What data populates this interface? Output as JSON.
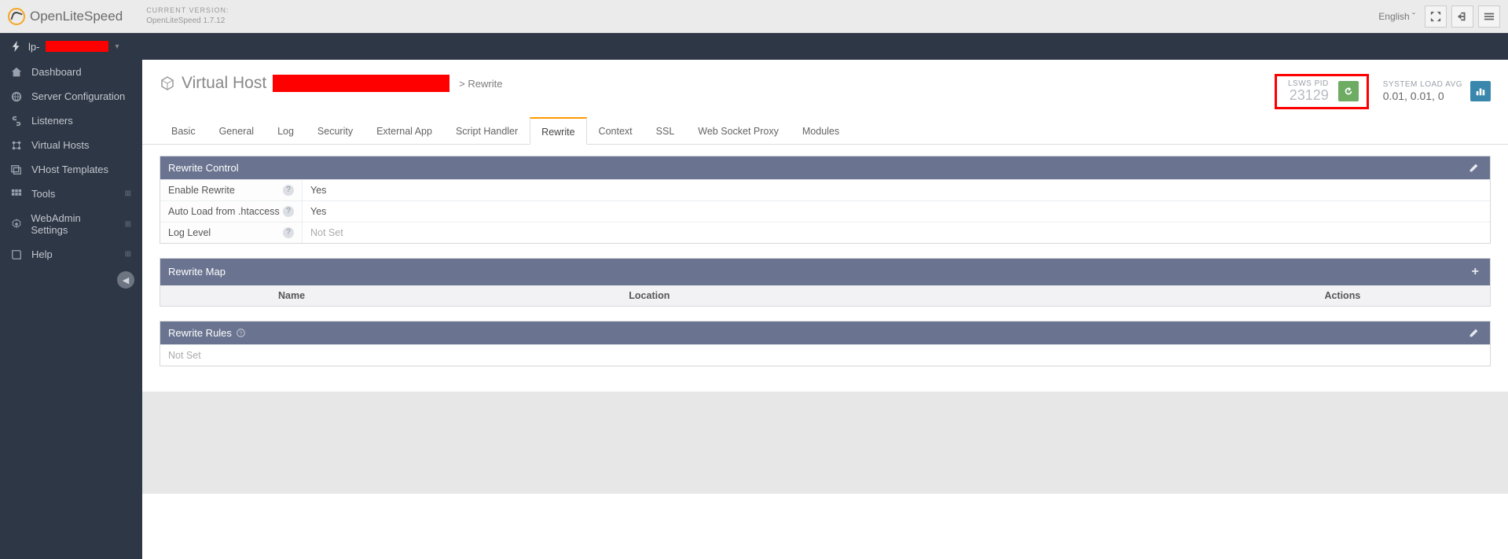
{
  "header": {
    "brand_thin": "Open",
    "brand_mid": "Lite",
    "brand_bold": "Speed",
    "current_version_label": "CURRENT VERSION:",
    "current_version_value": "OpenLiteSpeed 1.7.12",
    "language": "English"
  },
  "serverbar": {
    "prefix": "lp-"
  },
  "sidebar": {
    "items": [
      {
        "icon": "home",
        "label": "Dashboard"
      },
      {
        "icon": "globe",
        "label": "Server Configuration"
      },
      {
        "icon": "link",
        "label": "Listeners"
      },
      {
        "icon": "vhost",
        "label": "Virtual Hosts"
      },
      {
        "icon": "template",
        "label": "VHost Templates"
      },
      {
        "icon": "grid",
        "label": "Tools",
        "expand": true
      },
      {
        "icon": "gear",
        "label": "WebAdmin Settings",
        "expand": true
      },
      {
        "icon": "book",
        "label": "Help",
        "expand": true
      }
    ]
  },
  "page": {
    "title_prefix": "Virtual Host",
    "breadcrumb": "> Rewrite",
    "pid_label": "LSWS PID",
    "pid_value": "23129",
    "load_label": "SYSTEM LOAD AVG",
    "load_value": "0.01, 0.01, 0"
  },
  "tabs": [
    "Basic",
    "General",
    "Log",
    "Security",
    "External App",
    "Script Handler",
    "Rewrite",
    "Context",
    "SSL",
    "Web Socket Proxy",
    "Modules"
  ],
  "active_tab": "Rewrite",
  "panel_control": {
    "title": "Rewrite Control",
    "rows": [
      {
        "k": "Enable Rewrite",
        "v": "Yes",
        "notset": false
      },
      {
        "k": "Auto Load from .htaccess",
        "v": "Yes",
        "notset": false
      },
      {
        "k": "Log Level",
        "v": "Not Set",
        "notset": true
      }
    ]
  },
  "panel_map": {
    "title": "Rewrite Map",
    "col_name": "Name",
    "col_location": "Location",
    "col_actions": "Actions"
  },
  "panel_rules": {
    "title": "Rewrite Rules",
    "value": "Not Set"
  }
}
